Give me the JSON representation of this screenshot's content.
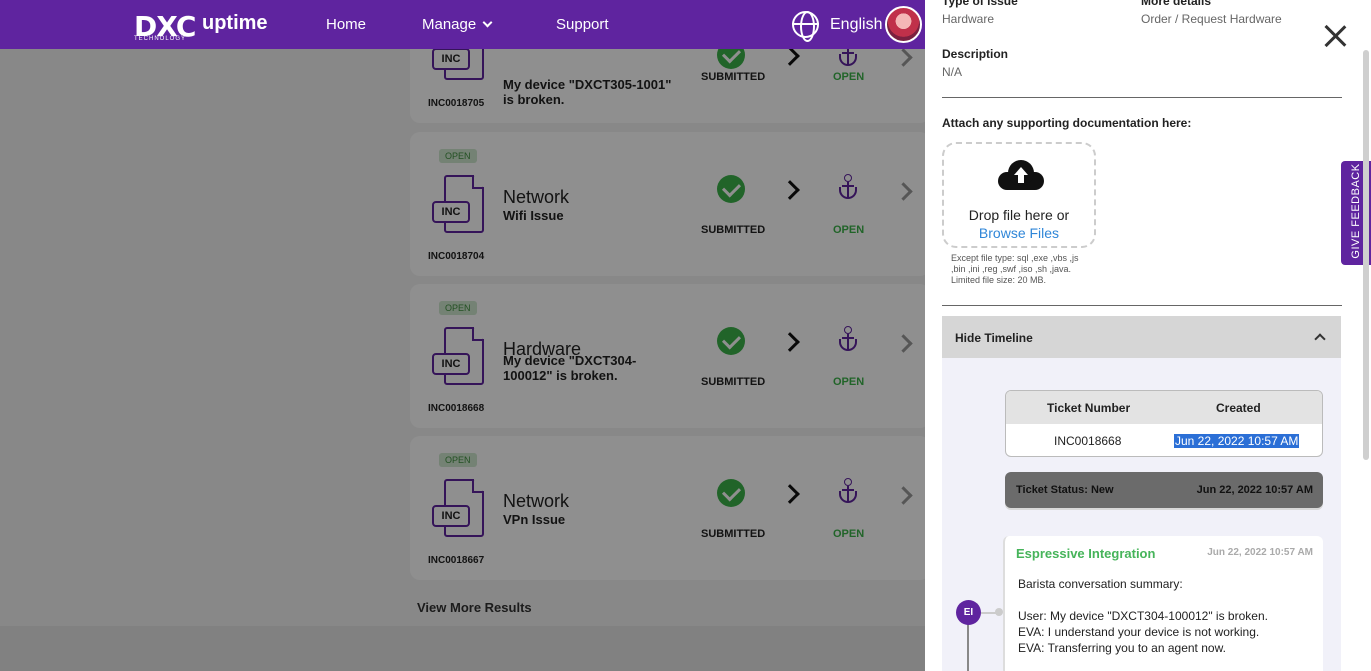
{
  "header": {
    "logo": "DXC",
    "logo_sub": "TECHNOLOGY",
    "logo_product": "uptime",
    "nav": [
      "Home",
      "Manage",
      "Support"
    ],
    "language": "English"
  },
  "tickets": [
    {
      "badge": "",
      "category": "",
      "description": "My device \"DXCT305-1001\" is broken.",
      "number": "INC0018705",
      "type_icon": "INC",
      "step1": "SUBMITTED",
      "step2": "OPEN"
    },
    {
      "badge": "OPEN",
      "category": "Network",
      "description": "Wifi Issue",
      "number": "INC0018704",
      "type_icon": "INC",
      "step1": "SUBMITTED",
      "step2": "OPEN"
    },
    {
      "badge": "OPEN",
      "category": "Hardware",
      "description": "My device \"DXCT304-100012\" is broken.",
      "number": "INC0018668",
      "type_icon": "INC",
      "step1": "SUBMITTED",
      "step2": "OPEN"
    },
    {
      "badge": "OPEN",
      "category": "Network",
      "description": "VPn Issue",
      "number": "INC0018667",
      "type_icon": "INC",
      "step1": "SUBMITTED",
      "step2": "OPEN"
    }
  ],
  "view_more": "View More Results",
  "panel": {
    "type_label": "Type of issue",
    "type_value": "Hardware",
    "details_label": "More details",
    "details_value": "Order / Request Hardware",
    "desc_label": "Description",
    "desc_value": "N/A",
    "attach_label": "Attach any supporting documentation here:",
    "drop_text": "Drop file here or",
    "browse": "Browse Files",
    "except_text": "Except file type: sql ,exe ,vbs ,js ,bin ,ini ,reg ,swf ,iso ,sh ,java.",
    "size_text": "Limited file size: 20 MB.",
    "timeline_toggle": "Hide Timeline",
    "table_headers": [
      "Ticket Number",
      "Created"
    ],
    "table_row": [
      "INC0018668",
      "Jun 22, 2022 10:57 AM"
    ],
    "status_text": "Ticket Status: New",
    "status_time": "Jun 22, 2022 10:57 AM",
    "msg_from": "Espressive Integration",
    "msg_time": "Jun 22, 2022 10:57 AM",
    "msg_lines": [
      "Barista conversation summary:",
      "User: My device \"DXCT304-100012\" is broken.",
      "EVA: I understand your device is not working.",
      "EVA: Transferring you to an agent now."
    ],
    "avatar_initials": "EI"
  },
  "feedback": "GIVE FEEDBACK",
  "colors": {
    "brand": "#5f249f",
    "success": "#3cb34a",
    "link": "#2f86d8"
  }
}
